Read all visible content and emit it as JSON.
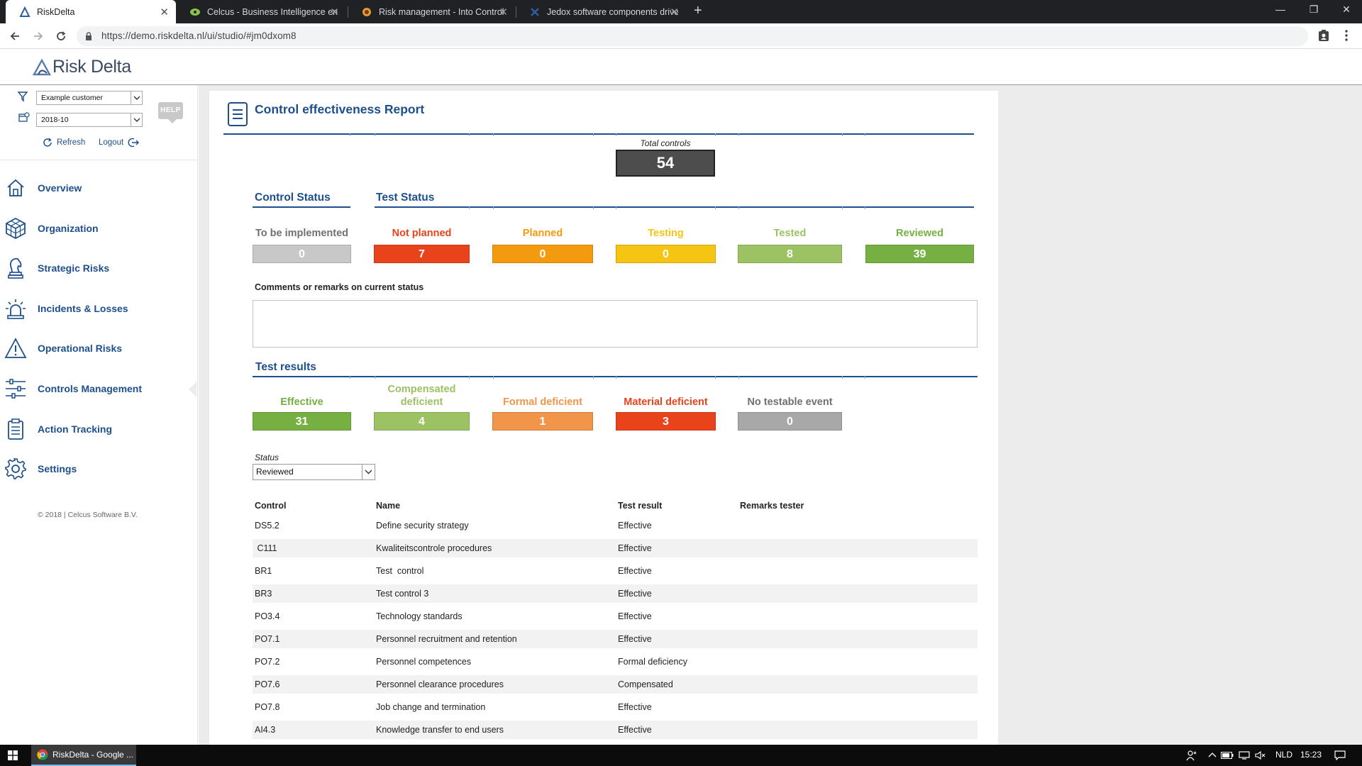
{
  "browser": {
    "tabs": [
      {
        "title": "RiskDelta",
        "active": true
      },
      {
        "title": "Celcus - Business Intelligence en",
        "active": false
      },
      {
        "title": "Risk management - Into Control",
        "active": false
      },
      {
        "title": "Jedox software components drive",
        "active": false
      }
    ],
    "url": "https://demo.riskdelta.nl/ui/studio/#jm0dxom8"
  },
  "app": {
    "brand": "Risk Delta"
  },
  "sidebar": {
    "customer_select": "Example customer",
    "period_select": "2018-10",
    "help_label": "HELP",
    "refresh_label": "Refresh",
    "logout_label": "Logout",
    "nav_items": [
      {
        "label": "Overview",
        "icon": "home-icon"
      },
      {
        "label": "Organization",
        "icon": "cube-icon"
      },
      {
        "label": "Strategic Risks",
        "icon": "chess-knight-icon"
      },
      {
        "label": "Incidents & Losses",
        "icon": "alarm-light-icon"
      },
      {
        "label": "Operational Risks",
        "icon": "warning-triangle-icon"
      },
      {
        "label": "Controls Management",
        "icon": "sliders-icon"
      },
      {
        "label": "Action Tracking",
        "icon": "clipboard-icon"
      },
      {
        "label": "Settings",
        "icon": "gear-icon"
      }
    ],
    "active_item": "Controls Management",
    "copyright": "© 2018 | Celcus Software B.V."
  },
  "report": {
    "title": "Control effectiveness Report",
    "total_label": "Total controls",
    "total_value": "54",
    "control_status_title": "Control Status",
    "test_status_title": "Test Status",
    "status_stats": [
      {
        "label": "To be implemented",
        "value": "0",
        "color": "#c8c8c8",
        "label_color": "#707070"
      },
      {
        "label": "Not planned",
        "value": "7",
        "color": "#e8431a",
        "label_color": "#e8431a"
      },
      {
        "label": "Planned",
        "value": "0",
        "color": "#f39a0e",
        "label_color": "#f39a0e"
      },
      {
        "label": "Testing",
        "value": "0",
        "color": "#f6c513",
        "label_color": "#f6c513"
      },
      {
        "label": "Tested",
        "value": "8",
        "color": "#9cc263",
        "label_color": "#9cc263"
      },
      {
        "label": "Reviewed",
        "value": "39",
        "color": "#76b043",
        "label_color": "#76b043"
      }
    ],
    "comments_label": "Comments or remarks on current status",
    "comments_value": "",
    "results_title": "Test results",
    "result_stats": [
      {
        "label": "Effective",
        "value": "31",
        "color": "#76b043",
        "label_color": "#76b043"
      },
      {
        "label": "Compensated deficient",
        "value": "4",
        "color": "#9cc263",
        "label_color": "#9cc263"
      },
      {
        "label": "Formal deficient",
        "value": "1",
        "color": "#f0954a",
        "label_color": "#f0954a"
      },
      {
        "label": "Material deficient",
        "value": "3",
        "color": "#e8431a",
        "label_color": "#e8431a"
      },
      {
        "label": "No testable event",
        "value": "0",
        "color": "#a8a8a8",
        "label_color": "#707070"
      }
    ],
    "status_filter_label": "Status",
    "status_filter_value": "Reviewed",
    "table": {
      "headers": [
        "Control",
        "Name",
        "Test result",
        "Remarks tester"
      ],
      "rows": [
        [
          "DS5.2",
          "Define security strategy",
          "Effective",
          ""
        ],
        [
          " C111",
          "Kwaliteitscontrole procedures",
          "Effective",
          ""
        ],
        [
          "BR1",
          "Test  control",
          "Effective",
          ""
        ],
        [
          "BR3",
          "Test control 3",
          "Effective",
          ""
        ],
        [
          "PO3.4",
          "Technology standards",
          "Effective",
          ""
        ],
        [
          "PO7.1",
          "Personnel recruitment and retention",
          "Effective",
          ""
        ],
        [
          "PO7.2",
          "Personnel competences",
          "Formal deficiency",
          ""
        ],
        [
          "PO7.6",
          "Personnel clearance procedures",
          "Compensated",
          ""
        ],
        [
          "PO7.8",
          "Job change and termination",
          "Effective",
          ""
        ],
        [
          "AI4.3",
          "Knowledge transfer to end users",
          "Effective",
          ""
        ]
      ]
    }
  },
  "taskbar": {
    "app_label": "RiskDelta - Google ...",
    "language": "NLD",
    "time": "15:23"
  }
}
